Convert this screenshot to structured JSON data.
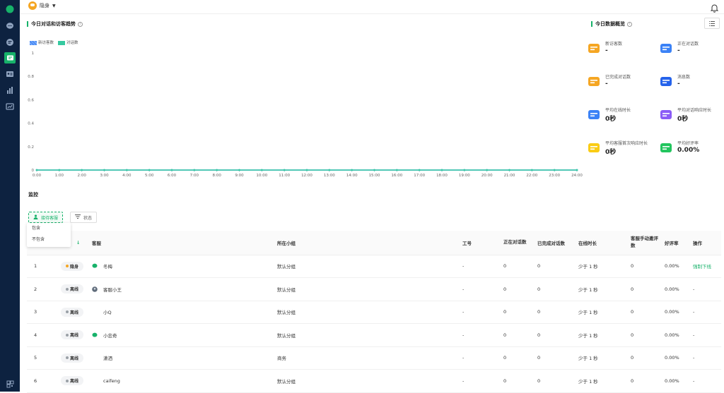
{
  "topbar": {
    "status_label": "隐身"
  },
  "trend": {
    "title": "今日对话和访客趋势",
    "legend": [
      "新访客数",
      "对话数"
    ]
  },
  "chart_data": {
    "type": "line",
    "title": "今日对话和访客趋势",
    "x": [
      "0:00",
      "1:00",
      "2:00",
      "3:00",
      "4:00",
      "5:00",
      "6:00",
      "7:00",
      "8:00",
      "9:00",
      "10:00",
      "11:00",
      "12:00",
      "13:00",
      "14:00",
      "15:00",
      "16:00",
      "17:00",
      "18:00",
      "19:00",
      "20:00",
      "21:00",
      "22:00",
      "23:00",
      "24:00"
    ],
    "y_ticks": [
      "0",
      "0.2",
      "0.4",
      "0.6",
      "0.8",
      "1"
    ],
    "ylim": [
      0,
      1
    ],
    "series": [
      {
        "name": "新访客数",
        "color": "#4a8cf5",
        "values": [
          0,
          0,
          0,
          0,
          0,
          0,
          0,
          0,
          0,
          0,
          0,
          0,
          0,
          0,
          0,
          0,
          0,
          0,
          0,
          0,
          0,
          0,
          0,
          0,
          0
        ]
      },
      {
        "name": "对话数",
        "color": "#36c9a0",
        "values": [
          0,
          0,
          0,
          0,
          0,
          0,
          0,
          0,
          0,
          0,
          0,
          0,
          0,
          0,
          0,
          0,
          0,
          0,
          0,
          0,
          0,
          0,
          0,
          0,
          0
        ]
      }
    ],
    "grid": false,
    "legend": "top-left"
  },
  "overview": {
    "title": "今日数据概览",
    "items": [
      {
        "label": "新访客数",
        "value": "-",
        "icon": "visitors-icon",
        "color": "#f5a623"
      },
      {
        "label": "正在对话数",
        "value": "-",
        "icon": "chatting-icon",
        "color": "#3b82f6"
      },
      {
        "label": "已完成对话数",
        "value": "-",
        "icon": "completed-icon",
        "color": "#f5a623"
      },
      {
        "label": "消息数",
        "value": "-",
        "icon": "messages-icon",
        "color": "#2563eb"
      },
      {
        "label": "平均在线时长",
        "value": "0秒",
        "icon": "online-time-icon",
        "color": "#3b82f6"
      },
      {
        "label": "平均对话响应时长",
        "value": "0秒",
        "icon": "response-time-icon",
        "color": "#8b5cf6"
      },
      {
        "label": "平均客服首次响应时长",
        "value": "0秒",
        "icon": "first-response-icon",
        "color": "#facc15"
      },
      {
        "label": "平均好评率",
        "value": "0.00%",
        "icon": "rating-icon",
        "color": "#22c55e"
      }
    ]
  },
  "monitor": {
    "title": "监控",
    "filter_agent": "接待客服",
    "filter_status": "状态",
    "dropdown": [
      "包含",
      "不包含"
    ],
    "columns": [
      "客服",
      "所在小组",
      "工号",
      "正在对话数",
      "已完成对话数",
      "在线时长",
      "客服手动邀评数",
      "好评率",
      "操作"
    ],
    "rows": [
      {
        "idx": "1",
        "status": "隐身",
        "status_color": "#f5a623",
        "name": "冬梅",
        "icon": "green",
        "group": "默认分组",
        "id": "-",
        "chatting": "0",
        "done": "0",
        "online": "少于 1 秒",
        "invites": "0",
        "rate": "0.00%",
        "op": "强制下线"
      },
      {
        "idx": "2",
        "status": "离线",
        "status_color": "#9aa0a6",
        "name": "客服小王",
        "icon": "gray",
        "group": "默认分组",
        "id": "-",
        "chatting": "0",
        "done": "0",
        "online": "少于 1 秒",
        "invites": "0",
        "rate": "0.00%",
        "op": "-"
      },
      {
        "idx": "3",
        "status": "离线",
        "status_color": "#9aa0a6",
        "name": "小Q",
        "icon": "",
        "group": "默认分组",
        "id": "-",
        "chatting": "0",
        "done": "0",
        "online": "少于 1 秒",
        "invites": "0",
        "rate": "0.00%",
        "op": "-"
      },
      {
        "idx": "4",
        "status": "离线",
        "status_color": "#9aa0a6",
        "name": "小忠奇",
        "icon": "green",
        "group": "默认分组",
        "id": "-",
        "chatting": "0",
        "done": "0",
        "online": "少于 1 秒",
        "invites": "0",
        "rate": "0.00%",
        "op": "-"
      },
      {
        "idx": "5",
        "status": "离线",
        "status_color": "#9aa0a6",
        "name": "潇洒",
        "icon": "",
        "group": "商务",
        "id": "-",
        "chatting": "0",
        "done": "0",
        "online": "少于 1 秒",
        "invites": "0",
        "rate": "0.00%",
        "op": "-"
      },
      {
        "idx": "6",
        "status": "离线",
        "status_color": "#9aa0a6",
        "name": "caifeng",
        "icon": "",
        "group": "默认分组",
        "id": "-",
        "chatting": "0",
        "done": "0",
        "online": "少于 1 秒",
        "invites": "0",
        "rate": "0.00%",
        "op": "-"
      }
    ]
  }
}
